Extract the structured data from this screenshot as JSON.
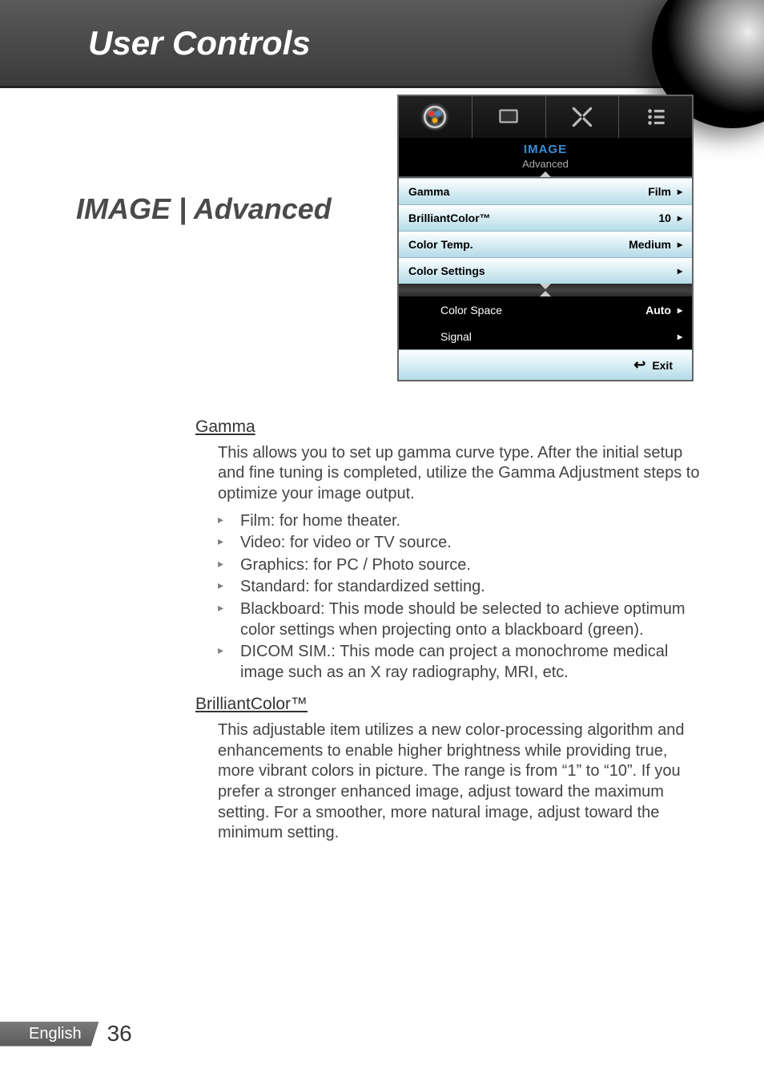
{
  "header": {
    "section_title": "User Controls",
    "page_heading": "IMAGE | Advanced"
  },
  "osd": {
    "tabs": [
      "image-icon",
      "display-icon",
      "setup-icon",
      "options-icon"
    ],
    "title": "IMAGE",
    "subtitle": "Advanced",
    "rows_top": [
      {
        "label": "Gamma",
        "value": "Film"
      },
      {
        "label": "BrilliantColor™",
        "value": "10"
      },
      {
        "label": "Color Temp.",
        "value": "Medium"
      },
      {
        "label": "Color Settings",
        "value": ""
      }
    ],
    "rows_bottom": [
      {
        "label": "Color Space",
        "value": "Auto"
      },
      {
        "label": "Signal",
        "value": ""
      }
    ],
    "footer": "Exit"
  },
  "content": {
    "gamma": {
      "heading": "Gamma",
      "intro": "This allows you to set up gamma curve type. After the initial setup and fine tuning is completed, utilize the Gamma Adjustment steps to optimize your image output.",
      "items": [
        "Film: for home theater.",
        "Video: for video or TV source.",
        "Graphics: for PC / Photo source.",
        "Standard: for standardized setting.",
        "Blackboard: This mode should be selected to achieve optimum color settings when projecting onto a blackboard (green).",
        "DICOM SIM.: This mode can project a monochrome medical image such as an X ray radiography, MRI, etc."
      ]
    },
    "brilliant": {
      "heading": "BrilliantColor™",
      "body": "This adjustable item utilizes a new color-processing algorithm and enhancements to enable higher brightness while providing true, more vibrant colors in picture. The range is from “1” to “10”. If you prefer a stronger enhanced image, adjust toward the maximum setting. For a smoother, more natural image, adjust toward the minimum setting."
    }
  },
  "footer": {
    "language": "English",
    "page": "36"
  }
}
